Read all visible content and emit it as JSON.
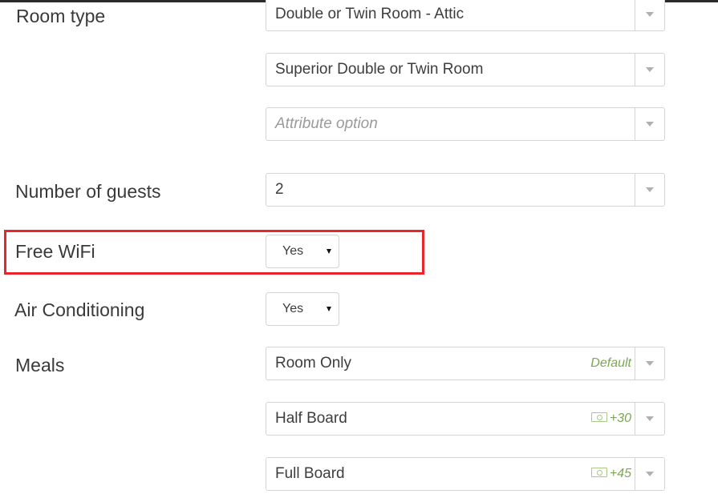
{
  "room_type": {
    "label": "Room type",
    "selects": [
      {
        "value": "Double or Twin Room - Attic"
      },
      {
        "value": "Superior Double or Twin Room"
      },
      {
        "placeholder": "Attribute option"
      }
    ]
  },
  "number_of_guests": {
    "label": "Number of guests",
    "value": "2"
  },
  "free_wifi": {
    "label": "Free WiFi",
    "value": "Yes",
    "highlighted": true,
    "highlight_color": "#e8262b"
  },
  "air_conditioning": {
    "label": "Air Conditioning",
    "value": "Yes"
  },
  "meals": {
    "label": "Meals",
    "options": [
      {
        "value": "Room Only",
        "badge": "Default"
      },
      {
        "value": "Half Board",
        "price": "+30",
        "icon": "money-icon"
      },
      {
        "value": "Full Board",
        "price": "+45",
        "icon": "money-icon"
      }
    ],
    "accent_color": "#7aa84f"
  }
}
